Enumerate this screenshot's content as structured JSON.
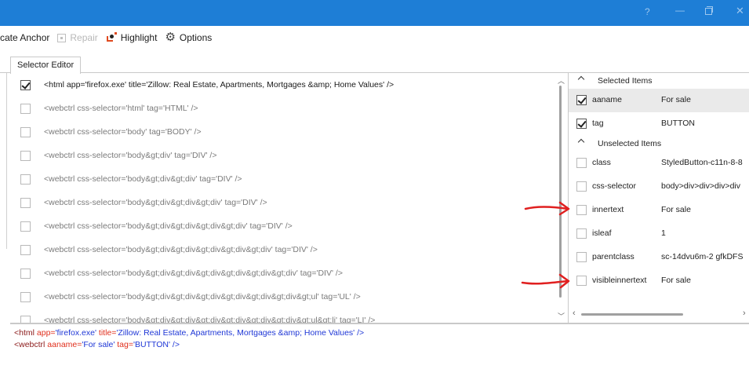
{
  "toolbar": {
    "items": [
      {
        "label": "cate Anchor",
        "icon": "none",
        "disabled": false
      },
      {
        "label": "Repair",
        "icon": "repair-icon",
        "disabled": true
      },
      {
        "label": "Highlight",
        "icon": "highlight-icon",
        "disabled": false
      },
      {
        "label": "Options",
        "icon": "gear-icon",
        "disabled": false
      }
    ]
  },
  "titlebar": {
    "help": "?",
    "minimize": "—",
    "close": "✕"
  },
  "tabs": [
    {
      "label": "Selector Editor",
      "active": true
    }
  ],
  "selector_rows": [
    {
      "checked": true,
      "text": "<html app='firefox.exe' title='Zillow: Real Estate, Apartments, Mortgages &amp; Home Values' />"
    },
    {
      "checked": false,
      "text": "<webctrl css-selector='html' tag='HTML' />"
    },
    {
      "checked": false,
      "text": "<webctrl css-selector='body' tag='BODY' />"
    },
    {
      "checked": false,
      "text": "<webctrl css-selector='body&gt;div' tag='DIV' />"
    },
    {
      "checked": false,
      "text": "<webctrl css-selector='body&gt;div&gt;div' tag='DIV' />"
    },
    {
      "checked": false,
      "text": "<webctrl css-selector='body&gt;div&gt;div&gt;div' tag='DIV' />"
    },
    {
      "checked": false,
      "text": "<webctrl css-selector='body&gt;div&gt;div&gt;div&gt;div' tag='DIV' />"
    },
    {
      "checked": false,
      "text": "<webctrl css-selector='body&gt;div&gt;div&gt;div&gt;div&gt;div' tag='DIV' />"
    },
    {
      "checked": false,
      "text": "<webctrl css-selector='body&gt;div&gt;div&gt;div&gt;div&gt;div&gt;div' tag='DIV' />"
    },
    {
      "checked": false,
      "text": "<webctrl css-selector='body&gt;div&gt;div&gt;div&gt;div&gt;div&gt;div&gt;ul' tag='UL' />"
    },
    {
      "checked": false,
      "text": "<webctrl css-selector='body&gt;div&gt;div&gt;div&gt;div&gt;div&gt;div&gt;ul&gt;li' tag='LI' />"
    }
  ],
  "right_panel": {
    "selected_header": "Selected Items",
    "unselected_header": "Unselected Items",
    "selected_items": [
      {
        "name": "aaname",
        "value": "For sale",
        "checked": true,
        "highlighted": true
      },
      {
        "name": "tag",
        "value": "BUTTON",
        "checked": true,
        "highlighted": false
      }
    ],
    "unselected_items": [
      {
        "name": "class",
        "value": "StyledButton-c11n-8-8",
        "checked": false
      },
      {
        "name": "css-selector",
        "value": "body>div>div>div>div",
        "checked": false
      },
      {
        "name": "innertext",
        "value": "For sale",
        "checked": false
      },
      {
        "name": "isleaf",
        "value": "1",
        "checked": false
      },
      {
        "name": "parentclass",
        "value": "sc-14dvu6m-2 gfkDFS",
        "checked": false
      },
      {
        "name": "visibleinnertext",
        "value": "For sale",
        "checked": false
      }
    ]
  },
  "preview": {
    "line1": {
      "tag": "<html",
      "attr1": " app=",
      "val1": "'firefox.exe'",
      "attr2": " title=",
      "val2": "'Zillow: Real Estate, Apartments, Mortgages &amp; Home Values'",
      "close": " />"
    },
    "line2": {
      "tag": "<webctrl",
      "attr1": " aaname=",
      "val1": "'For sale'",
      "attr2": " tag=",
      "val2": "'BUTTON'",
      "close": " />"
    }
  },
  "colors": {
    "titlebar": "#1e7ed6",
    "annotation_arrow": "#e02020",
    "preview_attr": "#e0301e",
    "preview_value": "#1f37d6"
  }
}
